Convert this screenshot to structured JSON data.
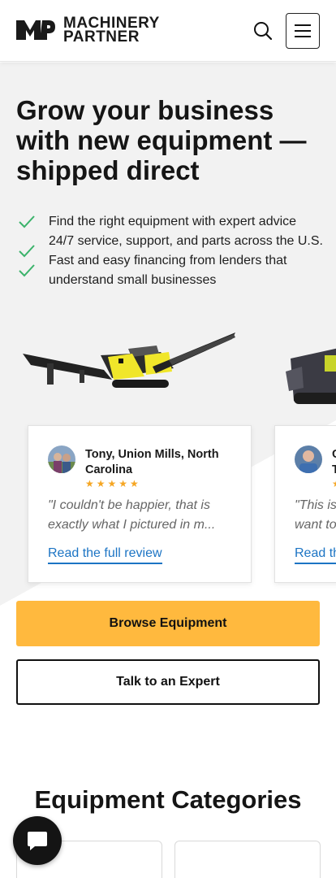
{
  "header": {
    "logo_line1": "MACHINERY",
    "logo_line2": "PARTNER",
    "search_icon": "search-icon",
    "menu_icon": "hamburger-menu-icon"
  },
  "hero": {
    "title": "Grow your business with new equipment — shipped direct",
    "benefits": [
      "Find the right equipment with expert advice",
      "24/7 service, support, and parts across the U.S.",
      "Fast and easy financing from lenders that understand small businesses"
    ],
    "check_color": "#3bb36b"
  },
  "reviews": [
    {
      "name": "Tony, Union Mills, North Carolina",
      "stars": "★★★★★",
      "quote_line1": "\"I couldn't be happier, that is",
      "quote_line2": "exactly what I pictured in m...",
      "link": "Read the full review"
    },
    {
      "name_line1": "C",
      "name_line2": "T",
      "stars": "★",
      "quote_line1": "\"This is",
      "quote_line2": "want to",
      "link": "Read th"
    }
  ],
  "actions": {
    "browse": "Browse Equipment",
    "expert": "Talk to an Expert"
  },
  "categories": {
    "title": "Equipment Categories"
  },
  "colors": {
    "accent": "#ffb93e",
    "link": "#1c74c4",
    "star": "#f5a623"
  },
  "chat_icon": "chat-bubble-icon"
}
